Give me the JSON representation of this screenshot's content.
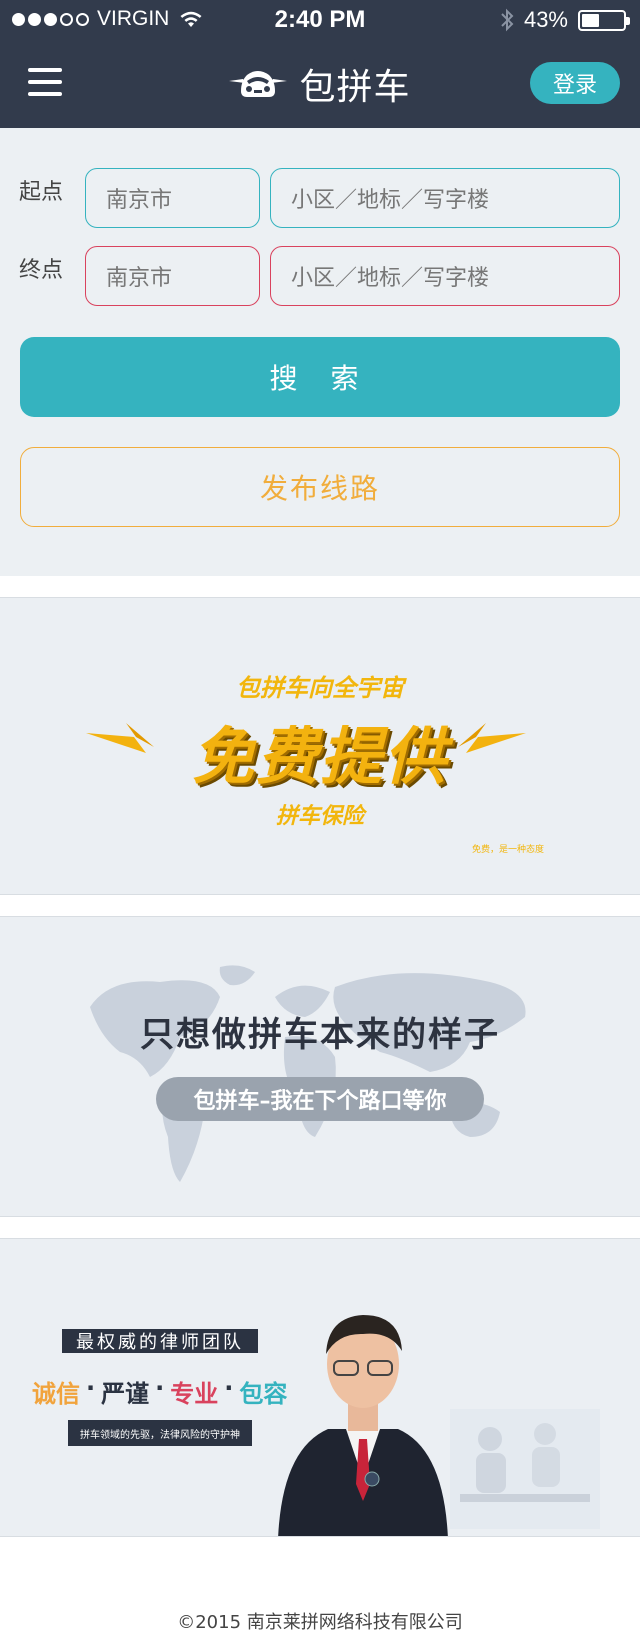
{
  "status_bar": {
    "carrier": "VIRGIN",
    "time": "2:40 PM",
    "battery": "43%",
    "battery_level": 0.43
  },
  "nav": {
    "title": "包拼车",
    "login": "登录"
  },
  "form": {
    "start_label": "起点",
    "end_label": "终点",
    "city_value": "南京市",
    "place_placeholder": "小区／地标／写字楼",
    "search": "搜 索",
    "publish": "发布线路"
  },
  "banner_free": {
    "top": "包拼车向全宇宙",
    "main": "免费提供",
    "sub": "拼车保险",
    "note": "免费，是一种态度"
  },
  "banner_map": {
    "title": "只想做拼车本来的样子",
    "slogan": "包拼车–我在下个路口等你"
  },
  "banner_lawyer": {
    "team": "最权威的律师团队",
    "values": [
      "诚信",
      "严谨",
      "专业",
      "包容"
    ],
    "separator": "·",
    "tagline": "拼车领域的先驱，法律风险的守护神"
  },
  "footer": {
    "copyright": "©2015 南京莱拼网络科技有限公司"
  },
  "colors": {
    "navbar": "#323b4c",
    "teal": "#35b3bf",
    "red": "#d9425d",
    "orange": "#f1ad3c",
    "page_bg": "#ecf0f3"
  }
}
